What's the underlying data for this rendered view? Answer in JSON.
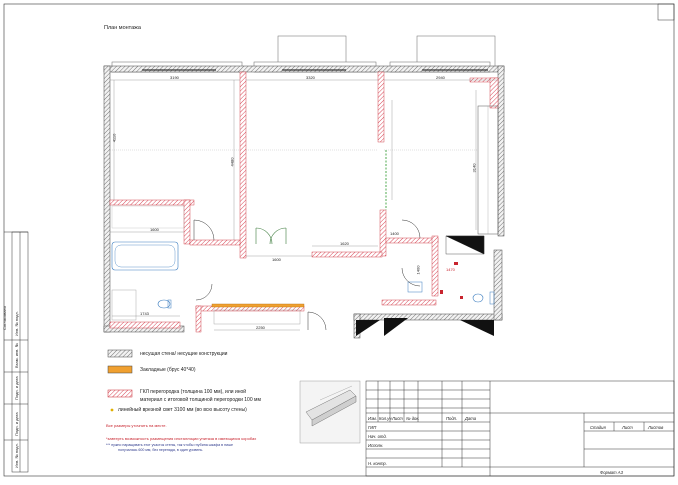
{
  "plan": {
    "title": "План монтажа"
  },
  "dimensions": {
    "d3190": "3190",
    "d3320": "3320",
    "d2940": "2940",
    "d4480": "4480",
    "d3140": "3140",
    "d1600a": "1600",
    "d1600b": "1600",
    "d1620": "1620",
    "d1400a": "1400",
    "d1400b": "1400",
    "d2250": "2250",
    "d1743": "1743",
    "d4110": "4110",
    "d1470": "1470"
  },
  "legend": {
    "wall": "несущая стена/ несущие конструкции",
    "embedded": "Закладные (брус 40*40)",
    "gkl_line1": "ГКЛ перегородка (толщина 100 мм), или иной",
    "gkl_line2": "материал с итоговой толщиной перегородки 100 мм",
    "opening": "линейный врезной свет 3100 мм (во всю высоту стены)"
  },
  "notes": {
    "all_sizes": "Все размеры уточнить на месте.",
    "check": "*завтерть возможность размещения инсталляции унитаза в имеющихся коробах",
    "blue1": "***  нужно наращивать этот участок стены, так чтобы глубина шкафа в нише",
    "blue2": "получалась 600 мм, без перепада, в один уровень."
  },
  "side": {
    "agreed": "Согласовано",
    "inv_podl": "Инв. № подл.",
    "podp_data": "Подп. и дата",
    "vzam_inv": "Взам. инв. №",
    "podp_data2": "Подп. и дата",
    "inv_podl2": "Инв. № подл."
  },
  "titleblock": {
    "izm": "Изм.",
    "koluch": "Кол.уч",
    "list": "Лист",
    "ndok": "№ док.",
    "podp": "Подп.",
    "data": "Дата",
    "gip": "ГИП",
    "nachotd": "Нач. отд.",
    "ispoln": "Исполн.",
    "nkontr": "Н. контр.",
    "stadia": "Стадия",
    "list2": "Лист",
    "listov": "Листов",
    "format": "Формат А3"
  }
}
